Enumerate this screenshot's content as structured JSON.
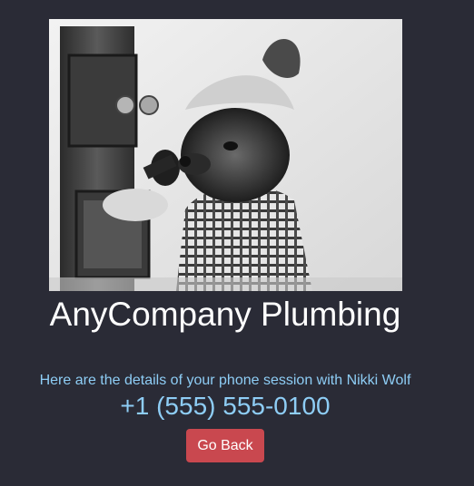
{
  "header": {
    "company_name": "AnyCompany Plumbing"
  },
  "session": {
    "intro_text": "Here are the details of your phone session with Nikki Wolf",
    "phone_number": "+1 (555) 555-0100"
  },
  "actions": {
    "back_label": "Go Back"
  },
  "colors": {
    "background": "#2a2b36",
    "accent_text": "#8ecdf5",
    "button": "#c9484f"
  }
}
